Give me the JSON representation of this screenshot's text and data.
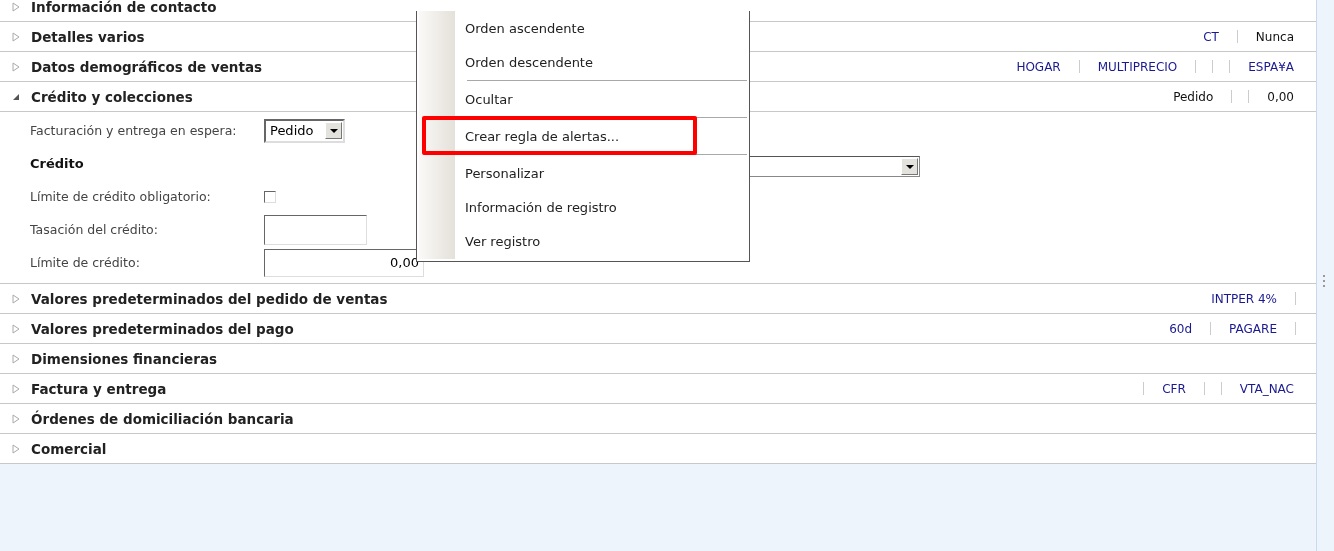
{
  "sections": [
    {
      "title": "Información de contacto",
      "expanded": false,
      "partial": true
    },
    {
      "title": "Detalles varios",
      "expanded": false,
      "summary": [
        {
          "kind": "link",
          "text": "CT"
        },
        {
          "kind": "divider"
        },
        {
          "kind": "plain",
          "text": "Nunca"
        }
      ]
    },
    {
      "title": "Datos demográficos de ventas",
      "expanded": false,
      "summary": [
        {
          "kind": "link",
          "text": "HOGAR"
        },
        {
          "kind": "divider"
        },
        {
          "kind": "link",
          "text": "MULTIPRECIO"
        },
        {
          "kind": "divider"
        },
        {
          "kind": "divider"
        },
        {
          "kind": "divider"
        },
        {
          "kind": "link",
          "text": "ESPA¥A"
        }
      ]
    },
    {
      "title": "Crédito y colecciones",
      "expanded": true,
      "summary": [
        {
          "kind": "plain",
          "text": "Pedido"
        },
        {
          "kind": "divider"
        },
        {
          "kind": "divider"
        },
        {
          "kind": "plain",
          "text": "0,00"
        }
      ],
      "fields": [
        {
          "kind": "select",
          "label": "Facturación y entrega en espera:",
          "value": "Pedido"
        },
        {
          "kind": "heading",
          "label": "Crédito"
        },
        {
          "kind": "checkbox",
          "label": "Límite de crédito obligatorio:",
          "checked": false
        },
        {
          "kind": "input",
          "label": "Tasación del crédito:"
        },
        {
          "kind": "number",
          "label": "Límite de crédito:",
          "value": "0,00"
        }
      ]
    },
    {
      "title": "Valores predeterminados del pedido de ventas",
      "expanded": false,
      "summary": [
        {
          "kind": "link",
          "text": "INTPER 4%"
        },
        {
          "kind": "divider"
        }
      ]
    },
    {
      "title": "Valores predeterminados del pago",
      "expanded": false,
      "summary": [
        {
          "kind": "link",
          "text": "60d"
        },
        {
          "kind": "divider"
        },
        {
          "kind": "link",
          "text": "PAGARE"
        },
        {
          "kind": "divider"
        }
      ]
    },
    {
      "title": "Dimensiones financieras",
      "expanded": false
    },
    {
      "title": "Factura y entrega",
      "expanded": false,
      "summary": [
        {
          "kind": "divider"
        },
        {
          "kind": "link",
          "text": "CFR"
        },
        {
          "kind": "divider"
        },
        {
          "kind": "divider"
        },
        {
          "kind": "link",
          "text": "VTA_NAC"
        }
      ]
    },
    {
      "title": "Órdenes de domiciliación bancaria",
      "expanded": false
    },
    {
      "title": "Comercial",
      "expanded": false
    }
  ],
  "context_menu": {
    "items": [
      {
        "kind": "item",
        "label": "Orden ascendente",
        "highlighted": false
      },
      {
        "kind": "item",
        "label": "Orden descendente",
        "highlighted": false
      },
      {
        "kind": "separator"
      },
      {
        "kind": "item",
        "label": "Ocultar",
        "highlighted": false
      },
      {
        "kind": "separator"
      },
      {
        "kind": "item",
        "label": "Crear regla de alertas...",
        "highlighted": true
      },
      {
        "kind": "separator"
      },
      {
        "kind": "item",
        "label": "Personalizar",
        "highlighted": false
      },
      {
        "kind": "item",
        "label": "Información de registro",
        "highlighted": false
      },
      {
        "kind": "item",
        "label": "Ver registro",
        "highlighted": false
      }
    ]
  }
}
